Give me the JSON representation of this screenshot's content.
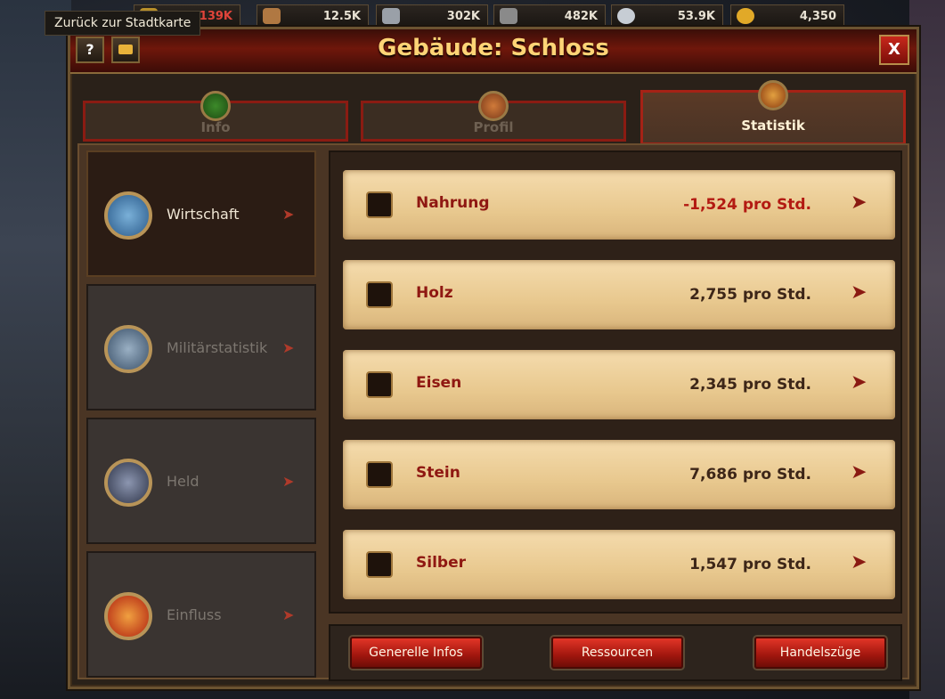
{
  "tooltip": "Zurück zur Stadtkarte",
  "resources": [
    {
      "name": "food",
      "value": "139K",
      "color": "#e0443a"
    },
    {
      "name": "wood",
      "value": "12.5K",
      "color": "#e8e2d4"
    },
    {
      "name": "iron",
      "value": "302K",
      "color": "#e8e2d4"
    },
    {
      "name": "stone",
      "value": "482K",
      "color": "#e8e2d4"
    },
    {
      "name": "silver",
      "value": "53.9K",
      "color": "#e8e2d4"
    },
    {
      "name": "gold",
      "value": "4,350",
      "color": "#e8e2d4"
    }
  ],
  "window": {
    "title": "Gebäude: Schloss",
    "help_label": "?",
    "close_label": "X"
  },
  "tabs": [
    {
      "label": "Info"
    },
    {
      "label": "Profil"
    },
    {
      "label": "Statistik",
      "active": true
    }
  ],
  "nav": [
    {
      "label": "Wirtschaft",
      "active": true
    },
    {
      "label": "Militärstatistik"
    },
    {
      "label": "Held"
    },
    {
      "label": "Einfluss"
    }
  ],
  "rows": [
    {
      "name": "Nahrung",
      "value": "-1,524 pro Std.",
      "icon": "wheat-icon"
    },
    {
      "name": "Holz",
      "value": "2,755 pro Std.",
      "icon": "wood-icon"
    },
    {
      "name": "Eisen",
      "value": "2,345 pro Std.",
      "icon": "iron-icon"
    },
    {
      "name": "Stein",
      "value": "7,686 pro Std.",
      "icon": "stone-icon"
    },
    {
      "name": "Silber",
      "value": "1,547 pro Std.",
      "icon": "silver-icon"
    }
  ],
  "bottom_buttons": [
    {
      "label": "Generelle Infos"
    },
    {
      "label": "Ressourcen"
    },
    {
      "label": "Handelszüge"
    }
  ],
  "colors": {
    "accent_red": "#a52216",
    "title_gold": "#ffd476",
    "parchment": "#e8c88e",
    "negative": "#b31a12"
  }
}
